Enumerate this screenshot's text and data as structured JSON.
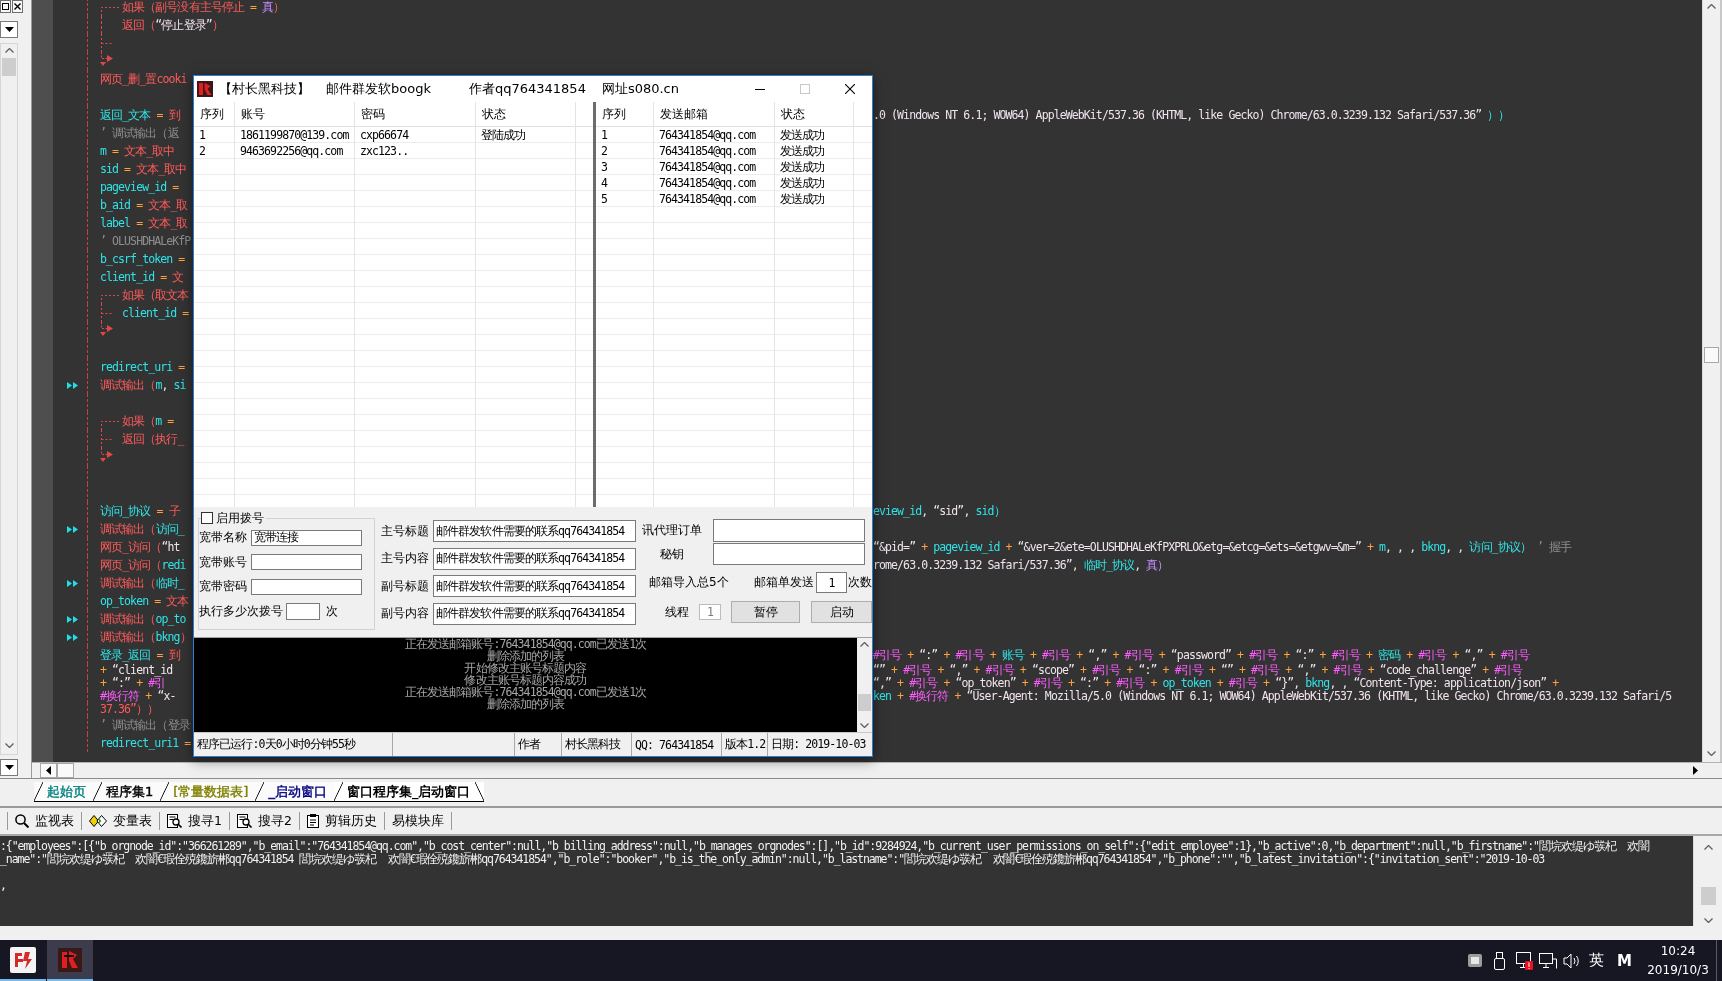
{
  "editor": {
    "lines": [
      {
        "kind": "if",
        "marked": false,
        "segments": [
          {
            "kind": "keyword",
            "text": "如果（副号没有主号停止"
          },
          {
            "kind": "operator",
            "text": " = "
          },
          {
            "kind": "truth",
            "text": "真"
          },
          {
            "kind": "keyword",
            "text": "）"
          }
        ],
        "children": [
          {
            "kind": "stmt",
            "marked": false,
            "segments": [
              {
                "kind": "keyword",
                "text": "返回（"
              },
              {
                "kind": "string",
                "text": "“停止登录”"
              },
              {
                "kind": "keyword",
                "text": "）"
              }
            ]
          },
          {
            "kind": "else",
            "marked": false
          }
        ]
      },
      {
        "kind": "stmt",
        "marked": false,
        "segments": [
          {
            "kind": "keyword",
            "text": "网页_删_置cooki"
          }
        ]
      },
      {
        "kind": "blank",
        "marked": false
      },
      {
        "kind": "stmt",
        "marked": false,
        "segments": [
          {
            "kind": "name",
            "text": "返回_文本"
          },
          {
            "kind": "operator",
            "text": " = "
          },
          {
            "kind": "keyword",
            "text": "到"
          }
        ],
        "tail": [
          {
            "kind": "string",
            "text": ".0 (Windows NT 6.1; WOW64) AppleWebKit/537.36 (KHTML, like Gecko) Chrome/63.0.3239.132 Safari/537.36”"
          },
          {
            "kind": "name",
            "text": " ））"
          }
        ]
      },
      {
        "kind": "stmt",
        "marked": false,
        "segments": [
          {
            "kind": "comment",
            "text": "’ 调试输出（返"
          }
        ]
      },
      {
        "kind": "stmt",
        "marked": false,
        "segments": [
          {
            "kind": "name",
            "text": "m"
          },
          {
            "kind": "operator",
            "text": " = "
          },
          {
            "kind": "keyword",
            "text": "文本_取中"
          }
        ]
      },
      {
        "kind": "stmt",
        "marked": false,
        "segments": [
          {
            "kind": "name",
            "text": "sid"
          },
          {
            "kind": "operator",
            "text": " = "
          },
          {
            "kind": "keyword",
            "text": "文本_取中"
          }
        ]
      },
      {
        "kind": "stmt",
        "marked": false,
        "segments": [
          {
            "kind": "name",
            "text": "pageview_id"
          },
          {
            "kind": "operator",
            "text": " ="
          }
        ]
      },
      {
        "kind": "stmt",
        "marked": false,
        "segments": [
          {
            "kind": "name",
            "text": "b_aid"
          },
          {
            "kind": "operator",
            "text": " = "
          },
          {
            "kind": "keyword",
            "text": "文本_取"
          }
        ]
      },
      {
        "kind": "stmt",
        "marked": false,
        "segments": [
          {
            "kind": "name",
            "text": "label"
          },
          {
            "kind": "operator",
            "text": " = "
          },
          {
            "kind": "keyword",
            "text": "文本_取"
          }
        ]
      },
      {
        "kind": "stmt",
        "marked": false,
        "segments": [
          {
            "kind": "comment",
            "text": "’ OLUSHDHALeKfP"
          }
        ]
      },
      {
        "kind": "stmt",
        "marked": false,
        "segments": [
          {
            "kind": "name",
            "text": "b_csrf_token"
          },
          {
            "kind": "operator",
            "text": " ="
          }
        ]
      },
      {
        "kind": "stmt",
        "marked": false,
        "segments": [
          {
            "kind": "name",
            "text": "client_id"
          },
          {
            "kind": "operator",
            "text": " = "
          },
          {
            "kind": "keyword",
            "text": "文"
          }
        ]
      },
      {
        "kind": "if",
        "marked": false,
        "segments": [
          {
            "kind": "keyword",
            "text": "如果（取文本"
          }
        ],
        "children": [
          {
            "kind": "else",
            "marked": false,
            "segments": [
              {
                "kind": "name",
                "text": "client_id"
              },
              {
                "kind": "operator",
                "text": " ="
              }
            ]
          }
        ]
      },
      {
        "kind": "blank",
        "marked": false
      },
      {
        "kind": "stmt",
        "marked": false,
        "segments": [
          {
            "kind": "name",
            "text": "redirect_uri"
          },
          {
            "kind": "operator",
            "text": " ="
          }
        ]
      },
      {
        "kind": "stmt",
        "marked": true,
        "segments": [
          {
            "kind": "keyword",
            "text": "调试输出（"
          },
          {
            "kind": "name",
            "text": "m"
          },
          {
            "kind": "plain",
            "text": ", "
          },
          {
            "kind": "name",
            "text": "si"
          }
        ]
      },
      {
        "kind": "blank",
        "marked": false
      },
      {
        "kind": "if",
        "marked": false,
        "segments": [
          {
            "kind": "keyword",
            "text": "如果（"
          },
          {
            "kind": "name",
            "text": "m"
          },
          {
            "kind": "operator",
            "text": " ="
          }
        ],
        "children": [
          {
            "kind": "else",
            "marked": false,
            "segments": [
              {
                "kind": "keyword",
                "text": "返回（执行_"
              }
            ]
          }
        ]
      },
      {
        "kind": "blank",
        "marked": false
      },
      {
        "kind": "blank",
        "marked": false
      },
      {
        "kind": "stmt",
        "marked": false,
        "segments": [
          {
            "kind": "name",
            "text": "访问_协议"
          },
          {
            "kind": "operator",
            "text": " = "
          },
          {
            "kind": "keyword",
            "text": "子"
          }
        ],
        "tail": [
          {
            "kind": "name",
            "text": "eview_id"
          },
          {
            "kind": "plain",
            "text": ", "
          },
          {
            "kind": "string",
            "text": "“sid”"
          },
          {
            "kind": "plain",
            "text": ", "
          },
          {
            "kind": "name",
            "text": "sid）"
          }
        ]
      },
      {
        "kind": "stmt",
        "marked": true,
        "segments": [
          {
            "kind": "keyword",
            "text": "调试输出（"
          },
          {
            "kind": "name",
            "text": "访问_"
          }
        ]
      },
      {
        "kind": "stmt",
        "marked": false,
        "segments": [
          {
            "kind": "keyword",
            "text": "网页_访问（"
          },
          {
            "kind": "string",
            "text": "“ht"
          }
        ],
        "tail": [
          {
            "kind": "string",
            "text": "“&pid=”"
          },
          {
            "kind": "operator",
            "text": " + "
          },
          {
            "kind": "name",
            "text": "pageview_id"
          },
          {
            "kind": "operator",
            "text": " + "
          },
          {
            "kind": "string",
            "text": "“&ver=2&ete=OLUSHDHALeKfPXPRLO&etg=&etcg=&ets=&etgwv=&m=”"
          },
          {
            "kind": "operator",
            "text": " + "
          },
          {
            "kind": "name",
            "text": "m"
          },
          {
            "kind": "plain",
            "text": ", , , "
          },
          {
            "kind": "name",
            "text": "bkng"
          },
          {
            "kind": "plain",
            "text": ", , "
          },
          {
            "kind": "name",
            "text": "访问_协议）"
          },
          {
            "kind": "comment",
            "text": " ’ 握手"
          }
        ]
      },
      {
        "kind": "stmt",
        "marked": false,
        "segments": [
          {
            "kind": "keyword",
            "text": "网页_访问（"
          },
          {
            "kind": "name",
            "text": "redi"
          }
        ],
        "tail": [
          {
            "kind": "string",
            "text": "rome/63.0.3239.132 Safari/537.36”"
          },
          {
            "kind": "plain",
            "text": ", "
          },
          {
            "kind": "name",
            "text": "临时_协议"
          },
          {
            "kind": "plain",
            "text": ", "
          },
          {
            "kind": "truth",
            "text": "真）"
          }
        ]
      },
      {
        "kind": "stmt",
        "marked": true,
        "segments": [
          {
            "kind": "keyword",
            "text": "调试输出（"
          },
          {
            "kind": "name",
            "text": "临时_"
          }
        ]
      },
      {
        "kind": "stmt",
        "marked": false,
        "segments": [
          {
            "kind": "name",
            "text": "op_token"
          },
          {
            "kind": "operator",
            "text": " = "
          },
          {
            "kind": "keyword",
            "text": "文本"
          }
        ]
      },
      {
        "kind": "stmt",
        "marked": true,
        "segments": [
          {
            "kind": "keyword",
            "text": "调试输出（"
          },
          {
            "kind": "name",
            "text": "op_to"
          }
        ]
      },
      {
        "kind": "stmt",
        "marked": true,
        "segments": [
          {
            "kind": "keyword",
            "text": "调试输出（"
          },
          {
            "kind": "name",
            "text": "bkng"
          },
          {
            "kind": "keyword",
            "text": "）"
          }
        ]
      },
      {
        "kind": "stmt",
        "marked": false,
        "segments": [
          {
            "kind": "name",
            "text": "登录_返回"
          },
          {
            "kind": "operator",
            "text": " = "
          },
          {
            "kind": "keyword",
            "text": "到"
          }
        ],
        "tail": [
          {
            "kind": "constant",
            "text": "#引号"
          },
          {
            "kind": "operator",
            "text": " + "
          },
          {
            "kind": "string",
            "text": "“:”"
          },
          {
            "kind": "operator",
            "text": " + "
          },
          {
            "kind": "constant",
            "text": "#引号"
          },
          {
            "kind": "operator",
            "text": " + "
          },
          {
            "kind": "name",
            "text": "账号"
          },
          {
            "kind": "operator",
            "text": " + "
          },
          {
            "kind": "constant",
            "text": "#引号"
          },
          {
            "kind": "operator",
            "text": " + "
          },
          {
            "kind": "string",
            "text": "“,”"
          },
          {
            "kind": "operator",
            "text": " + "
          },
          {
            "kind": "constant",
            "text": "#引号"
          },
          {
            "kind": "operator",
            "text": " + "
          },
          {
            "kind": "string",
            "text": "“password”"
          },
          {
            "kind": "operator",
            "text": " + "
          },
          {
            "kind": "constant",
            "text": "#引号"
          },
          {
            "kind": "operator",
            "text": " + "
          },
          {
            "kind": "string",
            "text": "“:”"
          },
          {
            "kind": "operator",
            "text": " + "
          },
          {
            "kind": "constant",
            "text": "#引号"
          },
          {
            "kind": "operator",
            "text": " + "
          },
          {
            "kind": "name",
            "text": "密码"
          },
          {
            "kind": "operator",
            "text": " + "
          },
          {
            "kind": "constant",
            "text": "#引号"
          },
          {
            "kind": "operator",
            "text": " + "
          },
          {
            "kind": "string",
            "text": "“,”"
          },
          {
            "kind": "operator",
            "text": " + "
          },
          {
            "kind": "constant",
            "text": "#引号"
          }
        ]
      },
      {
        "kind": "wrap",
        "marked": false,
        "segments": [
          {
            "kind": "operator",
            "text": "+ "
          },
          {
            "kind": "string",
            "text": "“client_id"
          }
        ],
        "tail": [
          {
            "kind": "string",
            "text": "“”"
          },
          {
            "kind": "operator",
            "text": " + "
          },
          {
            "kind": "constant",
            "text": "#引号"
          },
          {
            "kind": "operator",
            "text": " + "
          },
          {
            "kind": "string",
            "text": "“,”"
          },
          {
            "kind": "operator",
            "text": " + "
          },
          {
            "kind": "constant",
            "text": "#引号"
          },
          {
            "kind": "operator",
            "text": " + "
          },
          {
            "kind": "string",
            "text": "“scope”"
          },
          {
            "kind": "operator",
            "text": " + "
          },
          {
            "kind": "constant",
            "text": "#引号"
          },
          {
            "kind": "operator",
            "text": " + "
          },
          {
            "kind": "string",
            "text": "“:”"
          },
          {
            "kind": "operator",
            "text": " + "
          },
          {
            "kind": "constant",
            "text": "#引号"
          },
          {
            "kind": "operator",
            "text": " + "
          },
          {
            "kind": "string",
            "text": "“”"
          },
          {
            "kind": "operator",
            "text": " + "
          },
          {
            "kind": "constant",
            "text": "#引号"
          },
          {
            "kind": "operator",
            "text": " + "
          },
          {
            "kind": "string",
            "text": "“,”"
          },
          {
            "kind": "operator",
            "text": " + "
          },
          {
            "kind": "constant",
            "text": "#引号"
          },
          {
            "kind": "operator",
            "text": " + "
          },
          {
            "kind": "string",
            "text": "“code_challenge”"
          },
          {
            "kind": "operator",
            "text": " + "
          },
          {
            "kind": "constant",
            "text": "#引号"
          }
        ]
      },
      {
        "kind": "wrap",
        "marked": false,
        "segments": [
          {
            "kind": "operator",
            "text": "+ "
          },
          {
            "kind": "string",
            "text": "“:”"
          },
          {
            "kind": "operator",
            "text": " + "
          },
          {
            "kind": "constant",
            "text": "#引"
          }
        ],
        "tail": [
          {
            "kind": "string",
            "text": "“,”"
          },
          {
            "kind": "operator",
            "text": " + "
          },
          {
            "kind": "constant",
            "text": "#引号"
          },
          {
            "kind": "operator",
            "text": " + "
          },
          {
            "kind": "string",
            "text": "“op_token”"
          },
          {
            "kind": "operator",
            "text": " + "
          },
          {
            "kind": "constant",
            "text": "#引号"
          },
          {
            "kind": "operator",
            "text": " + "
          },
          {
            "kind": "string",
            "text": "“:”"
          },
          {
            "kind": "operator",
            "text": " + "
          },
          {
            "kind": "constant",
            "text": "#引号"
          },
          {
            "kind": "operator",
            "text": " + "
          },
          {
            "kind": "name",
            "text": "op_token"
          },
          {
            "kind": "operator",
            "text": " + "
          },
          {
            "kind": "constant",
            "text": "#引号"
          },
          {
            "kind": "operator",
            "text": " + "
          },
          {
            "kind": "string",
            "text": "“}”"
          },
          {
            "kind": "plain",
            "text": ", "
          },
          {
            "kind": "name",
            "text": "bkng"
          },
          {
            "kind": "plain",
            "text": ", , "
          },
          {
            "kind": "string",
            "text": "“Content-Type: application/json”"
          },
          {
            "kind": "operator",
            "text": " +"
          }
        ]
      },
      {
        "kind": "wrap",
        "marked": false,
        "segments": [
          {
            "kind": "constant",
            "text": "#换行符"
          },
          {
            "kind": "operator",
            "text": " + "
          },
          {
            "kind": "string",
            "text": "“x-"
          }
        ],
        "tail": [
          {
            "kind": "name",
            "text": "ken"
          },
          {
            "kind": "operator",
            "text": " + "
          },
          {
            "kind": "constant",
            "text": "#换行符"
          },
          {
            "kind": "operator",
            "text": " + "
          },
          {
            "kind": "string",
            "text": "“User-Agent: Mozilla/5.0 (Windows NT 6.1; WOW64) AppleWebKit/537.36 (KHTML, like Gecko) Chrome/63.0.3239.132 Safari/5"
          }
        ]
      },
      {
        "kind": "wrap",
        "marked": false,
        "segments": [
          {
            "kind": "keyword",
            "text": "37.36”））"
          }
        ]
      },
      {
        "kind": "stmt",
        "marked": false,
        "segments": [
          {
            "kind": "comment",
            "text": "’ 调试输出（登录"
          }
        ]
      },
      {
        "kind": "stmt",
        "marked": false,
        "segments": [
          {
            "kind": "name",
            "text": "redirect_uri1"
          },
          {
            "kind": "operator",
            "text": " ="
          }
        ]
      }
    ]
  },
  "dialog": {
    "title": [
      "【村长黑科技】",
      "邮件群发软boogk",
      "作者qq764341854",
      "网址s080.cn"
    ],
    "window_buttons": [
      {
        "kind": "minimize",
        "disabled": false
      },
      {
        "kind": "maximize",
        "disabled": true
      },
      {
        "kind": "close",
        "disabled": false
      }
    ],
    "accounts": {
      "columns": [
        "序列",
        "账号",
        "密码",
        "状态"
      ],
      "rows": [
        [
          "1",
          "1861199870@139.com",
          "cxp66674",
          "登陆成功"
        ],
        [
          "2",
          "9463692256@qq.com",
          "zxc123.."
        ]
      ]
    },
    "sent": {
      "columns": [
        "序列",
        "发送邮箱",
        "状态"
      ],
      "rows": [
        [
          "1",
          "764341854@qq.com",
          "发送成功"
        ],
        [
          "2",
          "764341854@qq.com",
          "发送成功"
        ],
        [
          "3",
          "764341854@qq.com",
          "发送成功"
        ],
        [
          "4",
          "764341854@qq.com",
          "发送成功"
        ],
        [
          "5",
          "764341854@qq.com",
          "发送成功"
        ]
      ]
    },
    "dialing": {
      "enable": {
        "label": "启用拨号",
        "checked": false
      },
      "fields": [
        {
          "label": "宽带名称",
          "value": "宽带连接"
        },
        {
          "label": "宽带账号"
        },
        {
          "label": "宽带密码"
        }
      ],
      "repeat": {
        "label": "执行多少次拨号",
        "unit": "次"
      }
    },
    "message_fields": [
      {
        "label": "主号标题",
        "value": "邮件群发软件需要的联系qq764341854"
      },
      {
        "label": "主号内容",
        "value": "邮件群发软件需要的联系qq764341854"
      },
      {
        "label": "副号标题",
        "value": "邮件群发软件需要的联系qq764341854"
      },
      {
        "label": "副号内容",
        "value": "邮件群发软件需要的联系qq764341854"
      }
    ],
    "proxy_fields": [
      {
        "label": "讯代理订单"
      },
      {
        "label": "秘钥"
      }
    ],
    "import_summary": "邮箱导入总5个",
    "per_mailbox": {
      "label": "邮箱单发送",
      "value": "1",
      "unit": "次数"
    },
    "threads": {
      "label": "线程",
      "value": "1",
      "disabled": true
    },
    "buttons": [
      "暂停",
      "启动"
    ],
    "log": [
      "正在发送邮箱账号:764341854@qq.com已发送1次",
      "删除添加的列表",
      "开始修改主账号标题内容",
      "修改主账号标题内容成功",
      "正在发送邮箱账号:764341854@qq.com已发送1次",
      "删除添加的列表"
    ],
    "status_bar": [
      "程序已运行:0天0小时0分钟55秒",
      "作者",
      "村长黑科技",
      "QQ: 764341854",
      "版本1.2",
      "日期: 2019-10-03"
    ]
  },
  "editor_tabs": [
    {
      "label": "起始页",
      "color": "#008080",
      "selected": false
    },
    {
      "label": "程序集1",
      "color": "#000000",
      "selected": false
    },
    {
      "label": "[常量数据表]",
      "color": "#808000",
      "selected": false
    },
    {
      "label": "_启动窗口",
      "color": "#000080",
      "selected": false
    },
    {
      "label": "窗口程序集_启动窗口",
      "color": "#000000",
      "selected": true
    }
  ],
  "panel_tabs": [
    {
      "kind": "watch",
      "label": "监视表"
    },
    {
      "kind": "variables",
      "label": "变量表"
    },
    {
      "kind": "search",
      "label": "搜寻1"
    },
    {
      "kind": "search",
      "label": "搜寻2"
    },
    {
      "kind": "history",
      "label": "剪辑历史"
    },
    {
      "kind": "library",
      "label": "易模块库"
    }
  ],
  "output": {
    "lines": [
      {
        "kind": "text",
        "text": ":{\"employees\":[{\"b_orgnode_id\":\"366261289\",\"b_email\":\"764341854@qq.com\",\"b_cost_center\":null,\"b_billing_address\":null,\"b_manages_orgnodes\":[],\"b_id\":9284924,\"b_current_user_permissions_on_self\":{\"edit_employee\":1},\"b_active\":0,\"b_department\":null,\"b_firstname\":\"閭垸欢缇ゆ彂杞  欢闇"
      },
      {
        "kind": "text",
        "text": "_name\":\"閭垸欢缇ゆ彂杞  欢闇€瑕佺殑鑱旂郴qq764341854 閭垸欢缇ゆ彂杞  欢闇€瑕佺殑鑱旂郴qq764341854\",\"b_role\":\"booker\",\"b_is_the_only_admin\":null,\"b_lastname\":\"閭垸欢缇ゆ彂杞  欢闇€瑕佺殑鑱旂郴qq764341854\",\"b_phone\":\"\",\"b_latest_invitation\":{\"invitation_sent\":\"2019-10-03"
      },
      {
        "kind": "blank"
      },
      {
        "kind": "text",
        "text": ","
      }
    ]
  },
  "taskbar": {
    "apps": [
      {
        "kind": "ide",
        "selected": false
      },
      {
        "kind": "mailer",
        "selected": true
      }
    ],
    "tray": {
      "language": "英",
      "ime_mode": "M",
      "time": "10:24",
      "date": "2019/10/3"
    }
  }
}
